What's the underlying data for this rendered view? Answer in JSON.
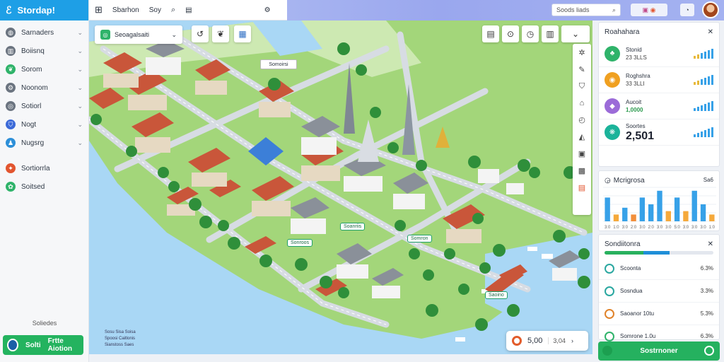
{
  "app": {
    "title": "Stordap!",
    "logo_glyph": "ℰ"
  },
  "topbar": {
    "tabs": [
      "Sbarhon",
      "Soy"
    ],
    "search_placeholder": "Soods liads",
    "colors": {
      "bar": "#9aa7ee",
      "brand": "#1e9fe6"
    }
  },
  "sidebar": {
    "items": [
      {
        "label": "Sarnaders",
        "icon": "globe-icon",
        "color": "#6b7480"
      },
      {
        "label": "Boiisnq",
        "icon": "book-icon",
        "color": "#6b7480"
      },
      {
        "label": "Sorom",
        "icon": "leaf-icon",
        "color": "#2fb36a"
      },
      {
        "label": "Noonom",
        "icon": "gear-icon",
        "color": "#6b7480"
      },
      {
        "label": "Sotiorl",
        "icon": "compass-icon",
        "color": "#6b7480"
      },
      {
        "label": "Nogt",
        "icon": "shield-icon",
        "color": "#3c6ad8"
      },
      {
        "label": "Nugsrg",
        "icon": "people-icon",
        "color": "#2d8fd8"
      },
      {
        "label": "Sortiorrla",
        "icon": "tools-icon",
        "color": "#e2552f"
      },
      {
        "label": "Soitsed",
        "icon": "sprout-icon",
        "color": "#2fb36a"
      }
    ],
    "footer_text": "Soliedes",
    "cta_left": "Solti",
    "cta_right": "Frtte Aiotion"
  },
  "map": {
    "chip_label": "Seoagalsaiti",
    "top_label": "Somoirsi",
    "labels": [
      "Soanriis",
      "Sonroos",
      "Somron",
      "Saoino"
    ],
    "credits": [
      "Sosu Sisa Soisa",
      "Spoosi Caitlonis",
      "Sianstoss Saes"
    ],
    "counter_value": "5,00",
    "counter_sub": "3,04"
  },
  "panel": {
    "resources_title": "Roahahara",
    "resources": [
      {
        "name": "Stonid",
        "value": "23 3LLS",
        "icon": "forest-icon",
        "color": "#2fb36a"
      },
      {
        "name": "Roghshra",
        "value": "33 3LLI",
        "icon": "coin-icon",
        "color": "#f0a020"
      },
      {
        "name": "Aucoit",
        "value": "1,0000",
        "icon": "crystal-icon",
        "color": "#9b6bd8"
      },
      {
        "name": "Soortes",
        "value": "2,501",
        "icon": "growth-icon",
        "color": "#1bb39a"
      }
    ],
    "chart_title": "Mcrigrosa",
    "chart_note": "Sa6",
    "objectives_title": "Sondiitonra",
    "objective_progress": 0.6,
    "objectives": [
      {
        "name": "Scoonta",
        "pct": "6.3%"
      },
      {
        "name": "Sosndua",
        "pct": "3.3%"
      },
      {
        "name": "Saoanor 10tu",
        "pct": "5.3%"
      },
      {
        "name": "Somrone 1.0u",
        "pct": "6.3%"
      }
    ],
    "cta_label": "Sostrnoner"
  },
  "chart_data": {
    "type": "bar",
    "title": "Mcrigrosa",
    "categories": [
      "3:0",
      "1:0",
      "3:0",
      "2:0",
      "3:0",
      "2:0",
      "3:0",
      "3:0",
      "5:0",
      "3:0",
      "3:0",
      "3:0",
      "1:0"
    ],
    "values": [
      70,
      20,
      40,
      20,
      70,
      50,
      90,
      30,
      70,
      30,
      90,
      50,
      20
    ],
    "colors": [
      "#37a1e8",
      "#f5a93b",
      "#37a1e8",
      "#f28f3b",
      "#37a1e8",
      "#37a1e8",
      "#37a1e8",
      "#f5a93b",
      "#37a1e8",
      "#f5a93b",
      "#37a1e8",
      "#37a1e8",
      "#f5a93b"
    ],
    "ylim": [
      0,
      100
    ],
    "grid": true
  }
}
